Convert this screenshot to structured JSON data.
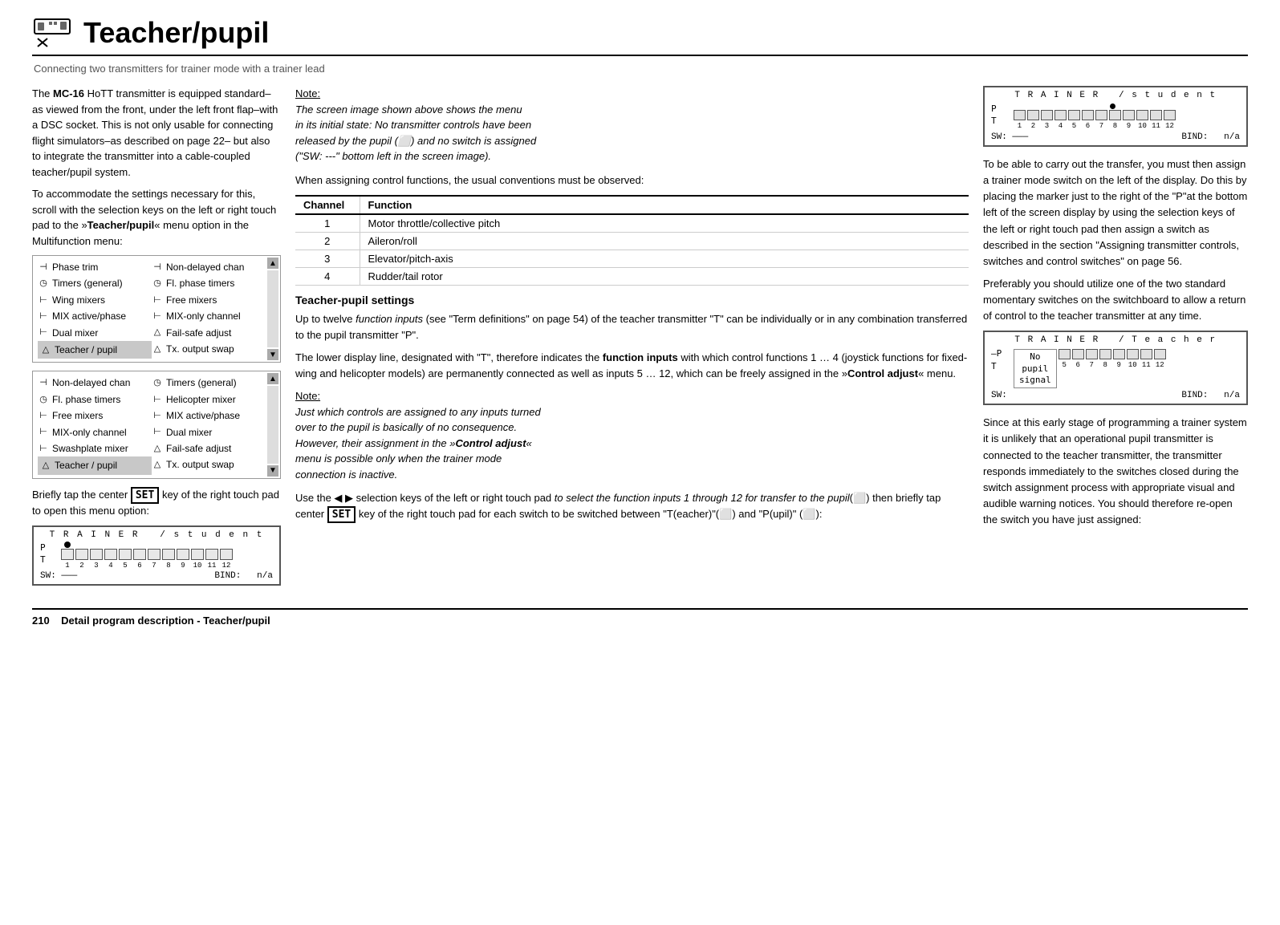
{
  "header": {
    "title": "Teacher/pupil",
    "subtitle": "Connecting two transmitters for trainer mode with a trainer lead"
  },
  "left_col": {
    "intro_text_1": "The MC-16 HoTT transmitter is equipped standard–as viewed from the front, under the left front flap–with a DSC socket. This is not only usable for connecting flight simulators–as described on page 22– but also to integrate the transmitter into a cable-coupled teacher/pupil system.",
    "intro_text_2": "To accommodate the settings necessary for this, scroll with the selection keys on the left or right touch pad to the »Teacher/pupil« menu option in the Multifunction menu:",
    "menu1": {
      "col1": [
        {
          "icon": "⊣",
          "label": "Phase trim"
        },
        {
          "icon": "◷",
          "label": "Timers (general)"
        },
        {
          "icon": "⊢",
          "label": "Wing mixers"
        },
        {
          "icon": "⊢",
          "label": "MIX active/phase"
        },
        {
          "icon": "⊢",
          "label": "Dual mixer"
        },
        {
          "icon": "△",
          "label": "Teacher / pupil",
          "highlighted": true
        }
      ],
      "col2": [
        {
          "icon": "⊣",
          "label": "Non-delayed chan"
        },
        {
          "icon": "◷",
          "label": "Fl. phase timers"
        },
        {
          "icon": "⊢",
          "label": "Free mixers"
        },
        {
          "icon": "⊢",
          "label": "MIX-only channel"
        },
        {
          "icon": "△",
          "label": "Fail-safe adjust"
        },
        {
          "icon": "△",
          "label": "Tx. output swap"
        }
      ]
    },
    "menu2": {
      "col1": [
        {
          "icon": "⊣",
          "label": "Non-delayed chan"
        },
        {
          "icon": "◷",
          "label": "Fl. phase timers"
        },
        {
          "icon": "⊢",
          "label": "Free mixers"
        },
        {
          "icon": "⊢",
          "label": "MIX-only channel"
        },
        {
          "icon": "⊢",
          "label": "Swashplate mixer"
        },
        {
          "icon": "△",
          "label": "Teacher / pupil",
          "highlighted": true
        }
      ],
      "col2": [
        {
          "icon": "◷",
          "label": "Timers (general)"
        },
        {
          "icon": "⊢",
          "label": "Helicopter mixer"
        },
        {
          "icon": "⊢",
          "label": "MIX active/phase"
        },
        {
          "icon": "⊢",
          "label": "Dual mixer"
        },
        {
          "icon": "△",
          "label": "Fail-safe adjust"
        },
        {
          "icon": "△",
          "label": "Tx. output swap"
        }
      ]
    },
    "brief_text": "Briefly tap the center SET key of the right touch pad to open this menu option:",
    "trainer_screen_left": {
      "top_line": "T R A I N E R   / s t u d e n t",
      "dot_col": 3,
      "pt_label": "P\nT",
      "numbers": [
        "1",
        "2",
        "3",
        "4",
        "5",
        "6",
        "7",
        "8",
        "9",
        "10",
        "11",
        "12"
      ],
      "sw_label": "SW: ———",
      "bind_label": "BIND:",
      "bind_value": "n/a"
    }
  },
  "middle_col": {
    "note1": {
      "title": "Note:",
      "lines": [
        "The screen image shown above shows the menu",
        "in its initial state: No transmitter controls have been",
        "released by the pupil (⬜) and no switch is assigned",
        "(\"SW: ---\" bottom left in the screen image)."
      ]
    },
    "assign_text": "When assigning control functions, the usual conventions must be observed:",
    "table": {
      "headers": [
        "Channel",
        "Function"
      ],
      "rows": [
        [
          "1",
          "Motor throttle/collective pitch"
        ],
        [
          "2",
          "Aileron/roll"
        ],
        [
          "3",
          "Elevator/pitch-axis"
        ],
        [
          "4",
          "Rudder/tail rotor"
        ]
      ]
    },
    "section_heading": "Teacher-pupil settings",
    "body1": "Up to twelve function inputs (see \"Term definitions\" on page 54) of the teacher transmitter \"T\" can be individually or in any combination transferred to the pupil transmitter \"P\".",
    "body2": "The lower display line, designated with \"T\", therefore indicates the function inputs with which control functions 1 … 4 (joystick functions for fixed-wing and helicopter models) are permanently connected as well as inputs 5 … 12, which can be freely assigned in the »Control adjust« menu.",
    "note2": {
      "title": "Note:",
      "lines": [
        "Just which controls are assigned to any inputs turned",
        "over to the pupil is basically of no consequence.",
        "However, their assignment in the »Control adjust«",
        "menu is possible only when the trainer mode",
        "connection is inactive."
      ]
    },
    "body3": "Use the ◀ ▶ selection keys of the left or right touch pad to select the function inputs 1 through 12 for transfer to the pupil(⬜) then briefly tap center SET key of the right touch pad for each switch to be switched between \"T(eacher)\"(⬜) and \"P(upil)\" (⬜):"
  },
  "right_col": {
    "trainer_screen_top": {
      "top_line": "T R A I N E R   / s t u d e n t",
      "dot_col": 10,
      "pt_label": "P\nT",
      "numbers": [
        "1",
        "2",
        "3",
        "4",
        "5",
        "6",
        "7",
        "8",
        "9",
        "10",
        "11",
        "12"
      ],
      "sw_label": "SW: ———",
      "bind_label": "BIND:",
      "bind_value": "n/a"
    },
    "text1": "To be able to carry out the transfer, you must then assign a trainer mode switch on the left of the display. Do this by placing the marker just to the right of the \"P\"at the bottom left of the screen display by using the selection keys of the left or right touch pad then assign a switch as described in the section \"Assigning transmitter controls, switches and control switches\" on page 56.",
    "text2": "Preferably you should utilize one of the two standard momentary switches on the switchboard to allow a return of control to the teacher transmitter at any time.",
    "trainer_screen_bottom": {
      "top_line": "T R A I N E R   / T e a c h e r",
      "pt_label": "–P\nT",
      "no_pupil_label": "No",
      "pupil_label": "pupil",
      "signal_label": "signal",
      "numbers": [
        "5",
        "6",
        "7",
        "8",
        "9",
        "10",
        "11",
        "12"
      ],
      "sw_label": "SW:",
      "bind_label": "BIND:",
      "bind_value": "n/a"
    },
    "text3": "Since at this early stage of programming a trainer system it is unlikely that an operational pupil transmitter is connected to the teacher transmitter, the transmitter responds immediately to the switches closed during the switch assignment process with appropriate visual and audible warning notices. You should therefore re-open the switch you have just assigned:"
  },
  "footer": {
    "page_number": "210",
    "label": "Detail program description - Teacher/pupil"
  }
}
